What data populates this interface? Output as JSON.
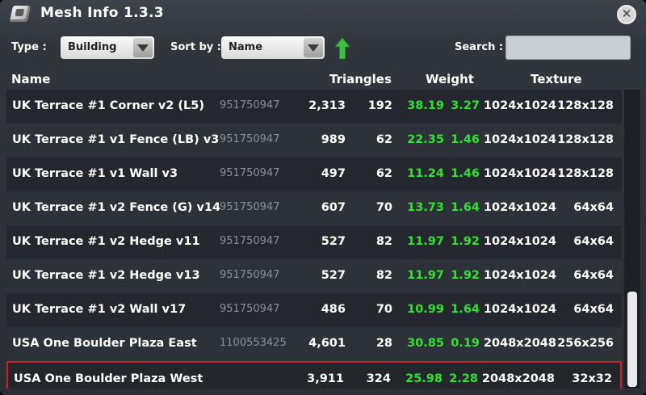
{
  "window": {
    "title": "Mesh Info 1.3.3",
    "close_label": "✕"
  },
  "filters": {
    "type_label": "Type :",
    "type_value": "Building",
    "sort_label": "Sort by :",
    "sort_value": "Name",
    "sort_direction": "ascending",
    "search_label": "Search :",
    "search_value": ""
  },
  "columns": {
    "name": "Name",
    "triangles": "Triangles",
    "weight": "Weight",
    "texture": "Texture"
  },
  "colors": {
    "weight_green": "#2fe22f",
    "selection_red": "#d2202a",
    "sort_arrow_green": "#3fbf3f"
  },
  "rows": [
    {
      "name": "UK Terrace #1 Corner v2 (L5)",
      "id": "951750947",
      "triangles": "2,313",
      "lod_triangles": "192",
      "weight": "38.19",
      "lod_weight": "3.27",
      "texture": "1024x1024",
      "lod_texture": "128x128"
    },
    {
      "name": "UK Terrace #1 v1 Fence (LB) v3",
      "id": "951750947",
      "triangles": "989",
      "lod_triangles": "62",
      "weight": "22.35",
      "lod_weight": "1.46",
      "texture": "1024x1024",
      "lod_texture": "128x128"
    },
    {
      "name": "UK Terrace #1 v1 Wall v3",
      "id": "951750947",
      "triangles": "497",
      "lod_triangles": "62",
      "weight": "11.24",
      "lod_weight": "1.46",
      "texture": "1024x1024",
      "lod_texture": "128x128"
    },
    {
      "name": "UK Terrace #1 v2 Fence (G) v14",
      "id": "951750947",
      "triangles": "607",
      "lod_triangles": "70",
      "weight": "13.73",
      "lod_weight": "1.64",
      "texture": "1024x1024",
      "lod_texture": "64x64"
    },
    {
      "name": "UK Terrace #1 v2 Hedge v11",
      "id": "951750947",
      "triangles": "527",
      "lod_triangles": "82",
      "weight": "11.97",
      "lod_weight": "1.92",
      "texture": "1024x1024",
      "lod_texture": "64x64"
    },
    {
      "name": "UK Terrace #1 v2 Hedge v13",
      "id": "951750947",
      "triangles": "527",
      "lod_triangles": "82",
      "weight": "11.97",
      "lod_weight": "1.92",
      "texture": "1024x1024",
      "lod_texture": "64x64"
    },
    {
      "name": "UK Terrace #1 v2 Wall v17",
      "id": "951750947",
      "triangles": "486",
      "lod_triangles": "70",
      "weight": "10.99",
      "lod_weight": "1.64",
      "texture": "1024x1024",
      "lod_texture": "64x64"
    },
    {
      "name": "USA One Boulder Plaza East",
      "id": "1100553425",
      "triangles": "4,601",
      "lod_triangles": "28",
      "weight": "30.85",
      "lod_weight": "0.19",
      "texture": "2048x2048",
      "lod_texture": "256x256"
    },
    {
      "name": "USA One Boulder Plaza West",
      "id": "",
      "triangles": "3,911",
      "lod_triangles": "324",
      "weight": "25.98",
      "lod_weight": "2.28",
      "texture": "2048x2048",
      "lod_texture": "32x32",
      "selected": true
    }
  ],
  "scroll_position": 0.95
}
